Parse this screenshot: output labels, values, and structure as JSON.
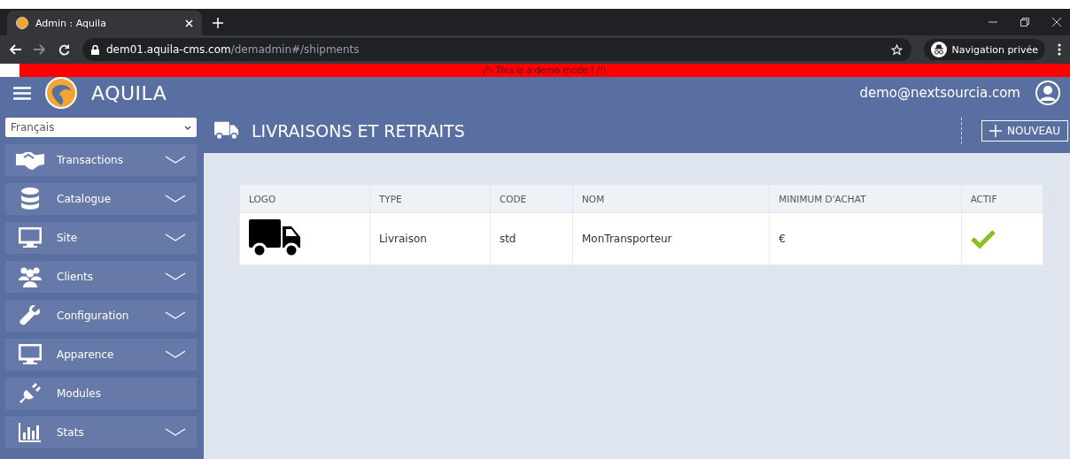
{
  "browser": {
    "tab_title": "Admin : Aquila",
    "url_host": "dem01.aquila-cms.com",
    "url_path": "/demadmin#/shipments",
    "incognito_label": "Navigation privée"
  },
  "demo_banner": "/!\\ This is a demo mode ! /!\\",
  "header": {
    "brand": "AQUILA",
    "user_email": "demo@nextsourcia.com"
  },
  "language_select": {
    "value": "Français"
  },
  "sidebar": {
    "items": [
      {
        "label": "Transactions",
        "expandable": true
      },
      {
        "label": "Catalogue",
        "expandable": true
      },
      {
        "label": "Site",
        "expandable": true
      },
      {
        "label": "Clients",
        "expandable": true
      },
      {
        "label": "Configuration",
        "expandable": true
      },
      {
        "label": "Apparence",
        "expandable": true
      },
      {
        "label": "Modules",
        "expandable": false
      },
      {
        "label": "Stats",
        "expandable": true
      }
    ]
  },
  "page": {
    "title": "LIVRAISONS ET RETRAITS",
    "new_button": "NOUVEAU"
  },
  "table": {
    "columns": [
      "LOGO",
      "TYPE",
      "CODE",
      "NOM",
      "MINIMUM D'ACHAT",
      "ACTIF"
    ],
    "rows": [
      {
        "type": "Livraison",
        "code": "std",
        "name": "MonTransporteur",
        "minimum": "€",
        "active": true
      }
    ]
  }
}
